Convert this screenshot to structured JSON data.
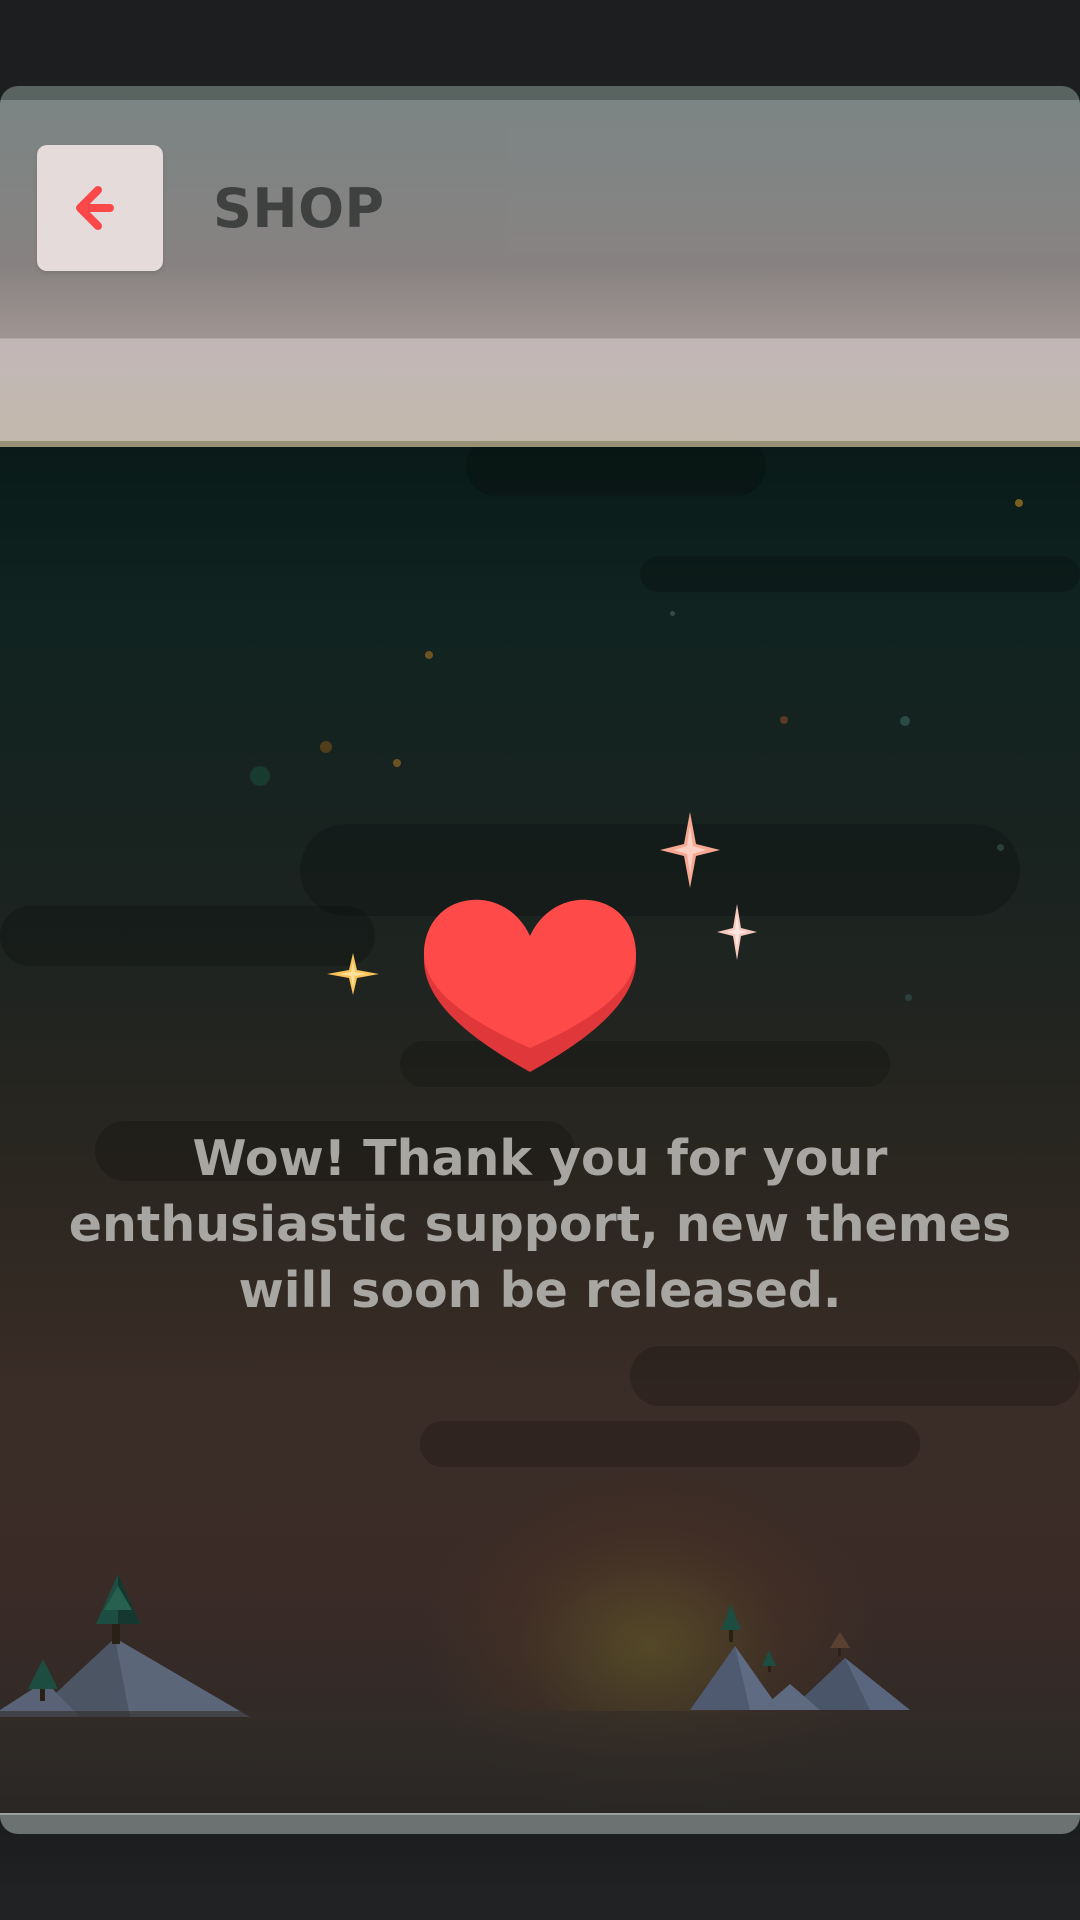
{
  "header": {
    "title": "SHOP",
    "back_icon": "arrow-left-icon"
  },
  "main": {
    "message": "Wow! Thank you for your enthusiastic support, new themes will soon be released.",
    "heart_icon": "heart-icon",
    "sparkle_icon": "sparkle-icon"
  },
  "colors": {
    "accent": "#ff4a4a",
    "header_bg": "#8a8584",
    "message_text": "#a7a6a2",
    "title_text": "#414141"
  }
}
